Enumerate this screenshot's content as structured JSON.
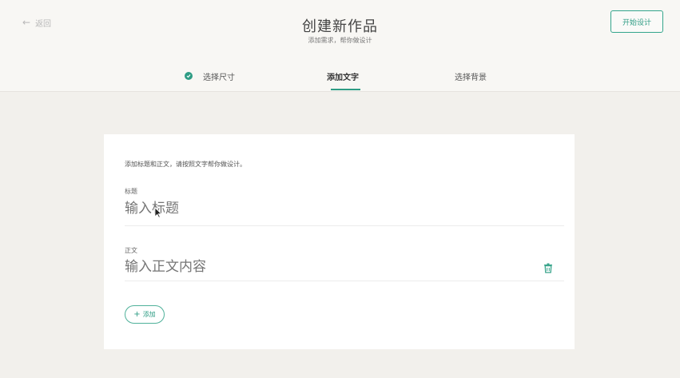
{
  "header": {
    "back_label": "返回",
    "title": "创建新作品",
    "subtitle": "添加需求，帮你做设计",
    "start_button": "开始设计"
  },
  "tabs": [
    {
      "label": "选择尺寸",
      "status": "completed"
    },
    {
      "label": "添加文字",
      "status": "active"
    },
    {
      "label": "选择背景",
      "status": "inactive"
    }
  ],
  "form": {
    "hint": "添加标题和正文，请按照文字帮你做设计。",
    "title_field": {
      "label": "标题",
      "placeholder": "输入标题"
    },
    "body_field": {
      "label": "正文",
      "placeholder": "输入正文内容"
    },
    "add_button": "添加"
  },
  "colors": {
    "accent": "#2e9c84",
    "background": "#f2f0ec",
    "card": "#ffffff"
  }
}
